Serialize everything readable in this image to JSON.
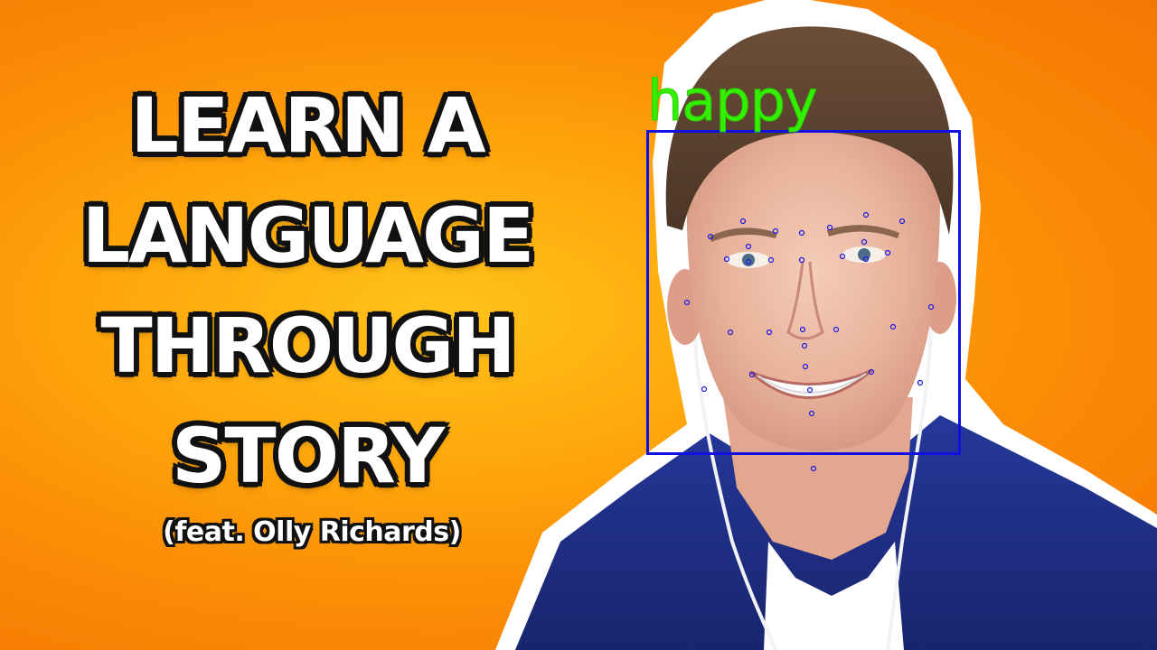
{
  "headline": {
    "line1": "LEARN A",
    "line2": "LANGUAGE",
    "line3": "THROUGH",
    "line4": "STORY"
  },
  "subtitle": "(feat. Olly Richards)",
  "face_detection": {
    "emotion_label": "happy",
    "box_color": "#1010e0",
    "label_color": "#33f000"
  },
  "colors": {
    "background_center": "#ffc21a",
    "background_edge": "#f47403",
    "headline_fill": "#ffffff",
    "headline_outline": "#111111",
    "shirt": "#1e2e86"
  }
}
